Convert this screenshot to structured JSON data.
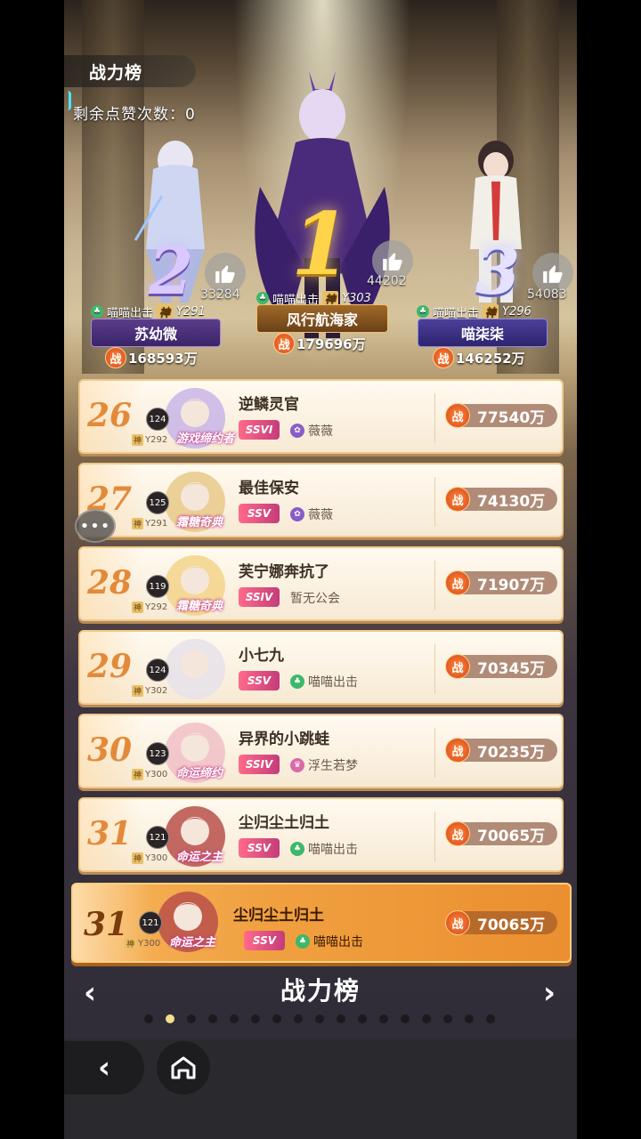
{
  "header": {
    "title": "战力榜",
    "likes_left": "剩余点赞次数：0"
  },
  "podium": [
    {
      "rank_label": "1",
      "guild": "喵喵出击",
      "god_tag": "神",
      "god_value": "Y303",
      "name": "风行航海家",
      "power_badge": "战",
      "power": "179696万",
      "likes": "44202",
      "color": "#ffd34a"
    },
    {
      "rank_label": "2",
      "guild": "喵喵出击",
      "god_tag": "神",
      "god_value": "Y291",
      "name": "苏幼微",
      "power_badge": "战",
      "power": "168593万",
      "likes": "33284",
      "color": "#d9c9ff"
    },
    {
      "rank_label": "3",
      "guild": "喵喵出击",
      "god_tag": "神",
      "god_value": "Y296",
      "name": "喵柒柒",
      "power_badge": "战",
      "power": "146252万",
      "likes": "54083",
      "color": "#e5e1ff"
    }
  ],
  "rows": [
    {
      "rank": "26",
      "level": "124",
      "god_tag": "神",
      "god_value": "Y292",
      "title_badge": "游戏缔约者",
      "name": "逆鳞灵官",
      "vip": "SSVI",
      "guild": "薇薇",
      "guild_icon": "flower-icon",
      "guild_color": "#8a5cc8",
      "power_badge": "战",
      "power": "77540万"
    },
    {
      "rank": "27",
      "level": "125",
      "god_tag": "神",
      "god_value": "Y291",
      "title_badge": "霜糖奇典",
      "name": "最佳保安",
      "vip": "SSV",
      "guild": "薇薇",
      "guild_icon": "flower-icon",
      "guild_color": "#8a5cc8",
      "power_badge": "战",
      "power": "74130万"
    },
    {
      "rank": "28",
      "level": "119",
      "god_tag": "神",
      "god_value": "Y292",
      "title_badge": "霜糖奇典",
      "name": "芙宁娜奔抗了",
      "vip": "SSIV",
      "guild": "暂无公会",
      "guild_icon": "",
      "guild_color": "",
      "power_badge": "战",
      "power": "71907万"
    },
    {
      "rank": "29",
      "level": "124",
      "god_tag": "神",
      "god_value": "Y302",
      "title_badge": "",
      "name": "小七九",
      "vip": "SSV",
      "guild": "喵喵出击",
      "guild_icon": "leaf-icon",
      "guild_color": "#3db86a",
      "power_badge": "战",
      "power": "70345万"
    },
    {
      "rank": "30",
      "level": "123",
      "god_tag": "神",
      "god_value": "Y300",
      "title_badge": "命运缔约",
      "name": "异界的小跳蛙",
      "vip": "SSIV",
      "guild": "浮生若梦",
      "guild_icon": "crown-icon",
      "guild_color": "#d86aa8",
      "power_badge": "战",
      "power": "70235万"
    },
    {
      "rank": "31",
      "level": "121",
      "god_tag": "神",
      "god_value": "Y300",
      "title_badge": "命运之主",
      "name": "尘归尘土归土",
      "vip": "SSV",
      "guild": "喵喵出击",
      "guild_icon": "leaf-icon",
      "guild_color": "#3db86a",
      "power_badge": "战",
      "power": "70065万"
    }
  ],
  "self_row": {
    "rank": "31",
    "level": "121",
    "god_tag": "神",
    "god_value": "Y300",
    "title_badge": "命运之主",
    "name": "尘归尘土归土",
    "vip": "SSV",
    "guild": "喵喵出击",
    "guild_icon": "leaf-icon",
    "guild_color": "#3db86a",
    "power_badge": "战",
    "power": "70065万"
  },
  "chat": {
    "label": "•••"
  },
  "footer": {
    "title": "战力榜",
    "prev": "‹",
    "next": "›",
    "page_count": 17,
    "active_page": 1
  },
  "nav": {
    "back": "‹"
  }
}
